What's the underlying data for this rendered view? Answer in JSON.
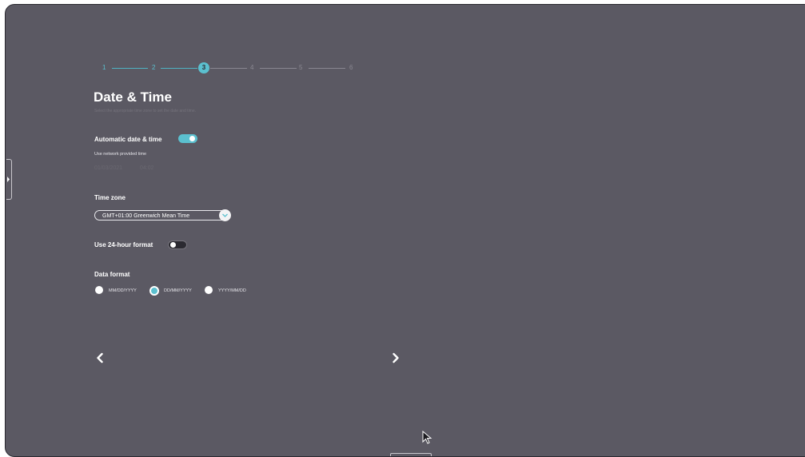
{
  "stepper": {
    "steps": [
      "1",
      "2",
      "3",
      "4",
      "5",
      "6"
    ],
    "active_step": 3
  },
  "page": {
    "title": "Date & Time",
    "subtitle": "Select the appropriate time zone to set the date and time."
  },
  "automatic": {
    "label": "Automatic date & time",
    "enabled": true,
    "hint": "Use network provided time",
    "date": "01/03/2021",
    "time": "04:02"
  },
  "timezone": {
    "label": "Time zone",
    "value": "GMT+01:00 Greenwich Mean Time"
  },
  "format24": {
    "label": "Use 24-hour format",
    "enabled": false
  },
  "date_format": {
    "label": "Data format",
    "options": [
      "MM/DD/YYYY",
      "DD/MM/YYYY",
      "YYYY/MM/DD"
    ],
    "selected": "DD/MM/YYYY"
  },
  "icons": {
    "prev": "chevron-left-icon",
    "next": "chevron-right-icon",
    "dropdown": "chevron-down-icon",
    "cursor": "mouse-pointer-icon"
  },
  "colors": {
    "background": "#5b5963",
    "accent": "#5bc0cf",
    "toggle_off": "#2b2a31"
  }
}
